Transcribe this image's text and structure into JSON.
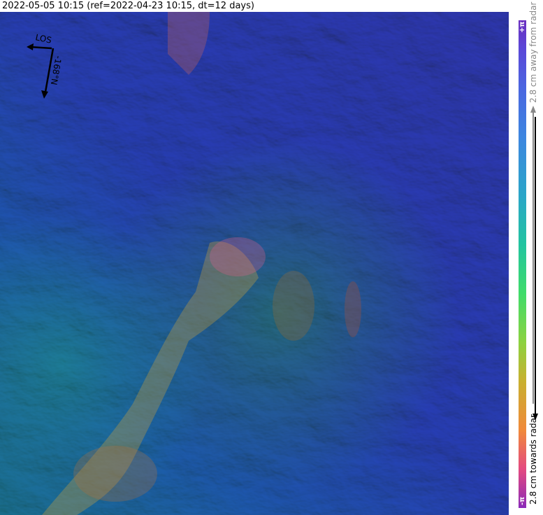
{
  "title": "2022-05-05 10:15 (ref=2022-04-23 10:15, dt=12 days)",
  "compass": {
    "los_label": "LOS",
    "heading_label": "-168°N"
  },
  "colorbar": {
    "top_label": "+π",
    "bottom_label": "-π",
    "away_label": "2.8 cm away from radar",
    "towards_label": "2.8 cm towards radar",
    "colors": [
      "#6b2fc0",
      "#4a66e0",
      "#2aa6c8",
      "#3fdc6a",
      "#c8b030",
      "#f08a3a",
      "#e44a80"
    ]
  }
}
